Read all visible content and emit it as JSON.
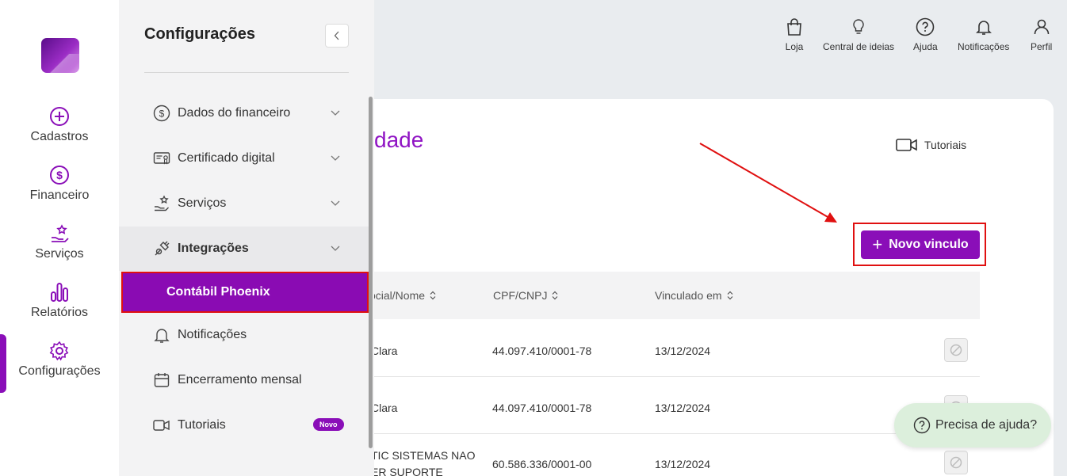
{
  "rail": {
    "items": [
      {
        "label": "Cadastros",
        "icon": "plus-circle-icon"
      },
      {
        "label": "Financeiro",
        "icon": "dollar-circle-icon"
      },
      {
        "label": "Serviços",
        "icon": "hand-star-icon"
      },
      {
        "label": "Relatórios",
        "icon": "bar-chart-icon"
      },
      {
        "label": "Configurações",
        "icon": "gear-icon"
      }
    ],
    "active": "Configurações"
  },
  "settings": {
    "title": "Configurações",
    "menu": [
      {
        "label": "Dados do financeiro",
        "icon": "dollar-circle-icon"
      },
      {
        "label": "Certificado digital",
        "icon": "certificate-icon"
      },
      {
        "label": "Serviços",
        "icon": "hand-star-icon"
      },
      {
        "label": "Integrações",
        "icon": "plug-icon"
      },
      {
        "label": "Notificações",
        "icon": "bell-icon"
      },
      {
        "label": "Encerramento mensal",
        "icon": "calendar-icon"
      },
      {
        "label": "Tutoriais",
        "icon": "video-icon",
        "badge": "Novo"
      }
    ],
    "submenu_selected": "Contábil Phoenix"
  },
  "topbar": {
    "items": [
      {
        "label": "Loja",
        "icon": "shopping-bag-icon"
      },
      {
        "label": "Central de ideias",
        "icon": "lightbulb-icon"
      },
      {
        "label": "Ajuda",
        "icon": "help-circle-icon"
      },
      {
        "label": "Notificações",
        "icon": "bell-icon"
      },
      {
        "label": "Perfil",
        "icon": "user-icon"
      }
    ]
  },
  "main": {
    "title_partial": "dade",
    "tutoriais_label": "Tutoriais",
    "new_link_label": "Novo vinculo",
    "columns": [
      "ocial/Nome",
      "CPF/CNPJ",
      "Vinculado em"
    ],
    "rows": [
      {
        "name": "Clara",
        "cnpj": "44.097.410/0001-78",
        "date": "13/12/2024"
      },
      {
        "name": "Clara",
        "cnpj": "44.097.410/0001-78",
        "date": "13/12/2024"
      },
      {
        "name_line1": "TIC SISTEMAS NAO",
        "name_line2": "ER SUPORTE",
        "cnpj": "60.586.336/0001-00",
        "date": "13/12/2024"
      }
    ]
  },
  "help": {
    "label": "Precisa de ajuda?"
  },
  "colors": {
    "accent": "#8a0eb8",
    "highlight": "#e01010",
    "help_bg": "#dcefdc"
  }
}
